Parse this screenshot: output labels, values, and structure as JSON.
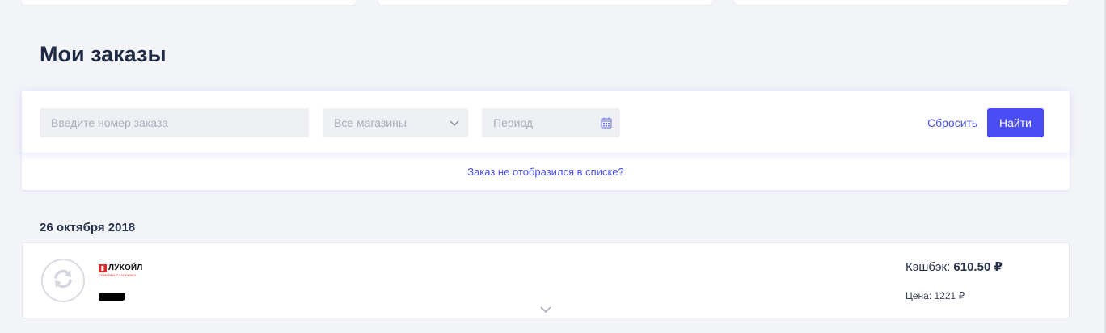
{
  "page_title": "Мои заказы",
  "filters": {
    "order_placeholder": "Введите номер заказа",
    "shops_selected": "Все магазины",
    "period_placeholder": "Период",
    "reset_label": "Сбросить",
    "find_label": "Найти"
  },
  "help_link": "Заказ не отобразился в списке?",
  "date_heading": "26 октября 2018",
  "order": {
    "store_logo_text": "ЛУКОЙЛ",
    "store_logo_subtext": "СЕМЕЙНАЯ ЗАПРАВКА",
    "cashback_label": "Кэшбэк:",
    "cashback_value": "610.50 ₽",
    "price_label": "Цена:",
    "price_value": "1221 ₽"
  },
  "colors": {
    "accent": "#4a4cf5",
    "link": "#4a52e8",
    "background": "#f3f4f8",
    "brand_lukoil": "#d42e2e"
  },
  "icons": {
    "status": "refresh-icon",
    "shops": "chevron-down-icon",
    "period": "calendar-icon",
    "expand": "chevron-down-icon"
  }
}
